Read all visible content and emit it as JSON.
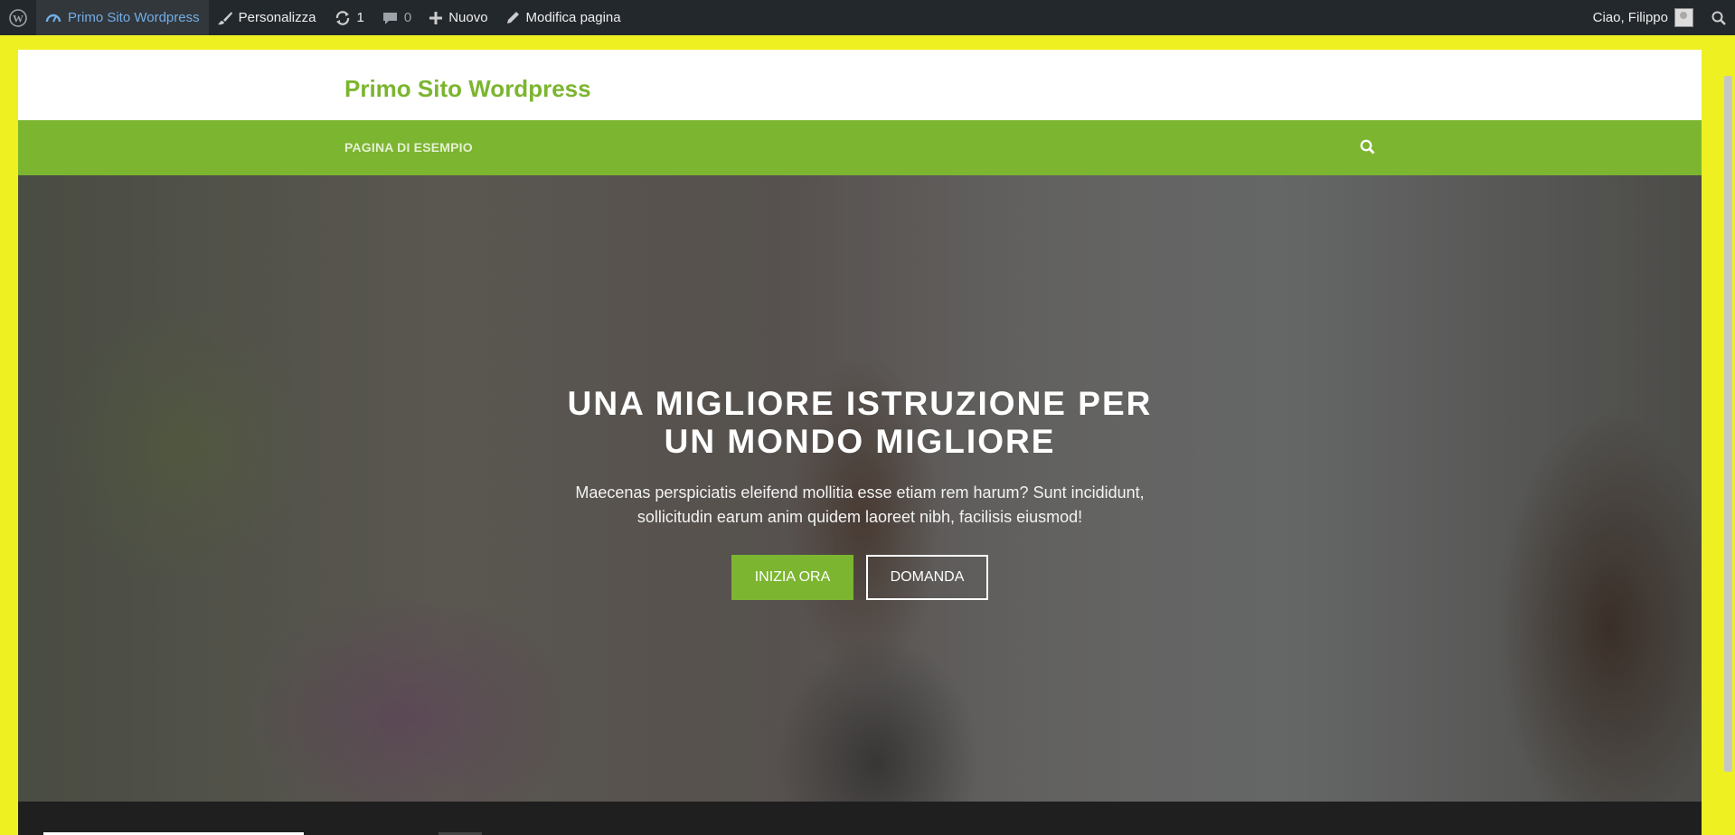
{
  "adminbar": {
    "site_name": "Primo Sito Wordpress",
    "customize": "Personalizza",
    "updates_count": "1",
    "comments_count": "0",
    "new_label": "Nuovo",
    "edit_page": "Modifica pagina",
    "greeting": "Ciao, Filippo"
  },
  "site": {
    "title": "Primo Sito Wordpress",
    "nav_item": "PAGINA DI ESEMPIO"
  },
  "hero": {
    "title_line1": "UNA MIGLIORE ISTRUZIONE PER",
    "title_line2": "UN MONDO MIGLIORE",
    "text_line1": "Maecenas perspiciatis eleifend mollitia esse etiam rem harum? Sunt incididunt,",
    "text_line2": "sollicitudin earum anim quidem laoreet nibh, facilisis eiusmod!",
    "primary_button": "INIZIA ORA",
    "secondary_button": "DOMANDA"
  },
  "colors": {
    "accent_green": "#7cb530",
    "admin_bar": "#23282d",
    "page_background": "#eef022"
  },
  "icons": [
    "wordpress-icon",
    "dashboard-icon",
    "brush-icon",
    "updates-icon",
    "comment-icon",
    "plus-icon",
    "pencil-icon",
    "search-icon",
    "avatar"
  ]
}
